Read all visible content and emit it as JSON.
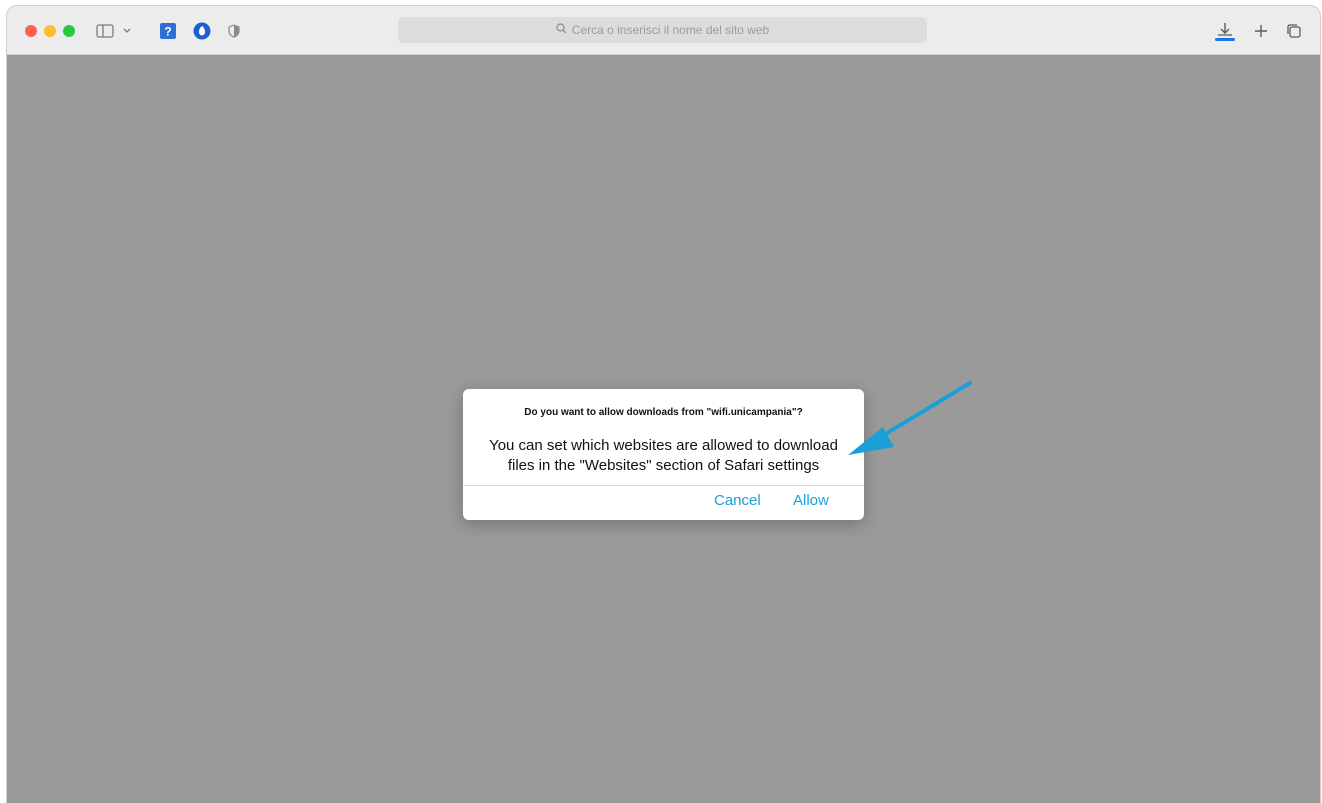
{
  "browser": {
    "address_bar": {
      "placeholder": "Cerca o inserisci il nome del sito web"
    },
    "toolbar_icons": [
      "sidebar-icon",
      "chevron-down-icon",
      "help-extension-icon",
      "privacy-extension-icon",
      "shield-icon",
      "download-icon",
      "plus-icon",
      "tabs-overview-icon"
    ],
    "download_progress": 1.0
  },
  "dialog": {
    "title": "Do you want to allow downloads from \"wifi.unicampania\"?",
    "message_line1": "You can set which websites are allowed to download",
    "message_line2": "files in the \"Websites\" section of Safari settings",
    "cancel_label": "Cancel",
    "allow_label": "Allow"
  },
  "colors": {
    "accent": "#1aa0d8",
    "download_bar": "#1478e6",
    "backdrop": "#9a9a9a",
    "annotation_arrow": "#1aa0d8"
  }
}
